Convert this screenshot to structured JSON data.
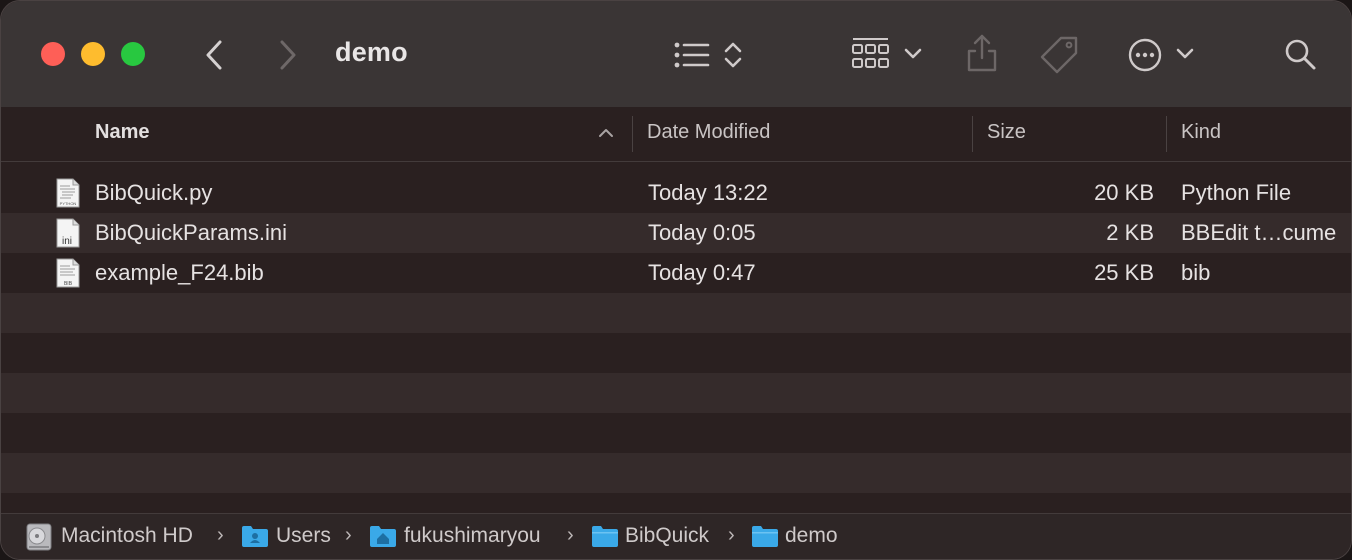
{
  "window": {
    "title": "demo"
  },
  "toolbar": {
    "icons": [
      "back-chevron-icon",
      "forward-chevron-icon",
      "list-view-icon",
      "updown-chevron-icon",
      "icon-grid-group-icon",
      "chevron-down-icon",
      "share-icon",
      "tag-icon",
      "more-icon",
      "chevron-down-icon",
      "search-icon"
    ]
  },
  "columns": {
    "name": "Name",
    "date": "Date Modified",
    "size": "Size",
    "kind": "Kind"
  },
  "files": [
    {
      "name": "BibQuick.py",
      "date": "Today 13:22",
      "size": "20 KB",
      "kind": "Python File",
      "icon": "python-file-icon",
      "icon_label": "PYTHON"
    },
    {
      "name": "BibQuickParams.ini",
      "date": "Today 0:05",
      "size": "2 KB",
      "kind": "BBEdit t…cume",
      "icon": "ini-file-icon",
      "icon_label": "ini"
    },
    {
      "name": "example_F24.bib",
      "date": "Today 0:47",
      "size": "25 KB",
      "kind": "bib",
      "icon": "bib-file-icon",
      "icon_label": "BIB"
    }
  ],
  "pathbar": [
    {
      "label": "Macintosh HD",
      "icon": "hard-drive-icon"
    },
    {
      "label": "Users",
      "icon": "users-folder-icon"
    },
    {
      "label": "fukushimaryou",
      "icon": "home-folder-icon"
    },
    {
      "label": "BibQuick",
      "icon": "folder-icon"
    },
    {
      "label": "demo",
      "icon": "folder-icon"
    }
  ],
  "colors": {
    "toolbar_bg": "#3a3535",
    "content_bg": "#2a2020",
    "alt_row_bg": "#352b2b",
    "folder_blue": "#3aa9e8"
  }
}
